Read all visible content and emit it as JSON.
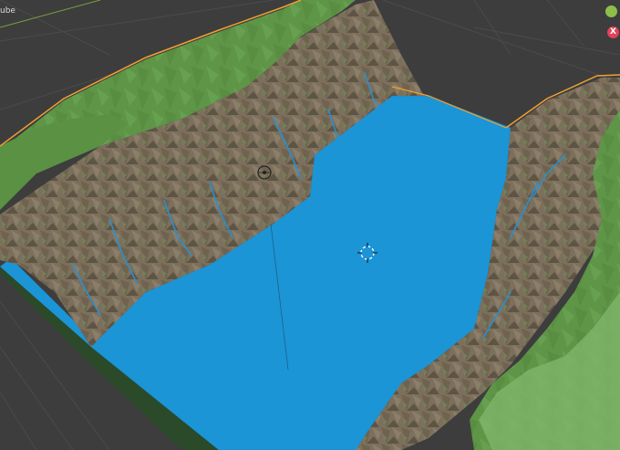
{
  "viewport": {
    "object_label": "ube",
    "gizmo": {
      "x_label": "X",
      "z_label": ""
    },
    "colors": {
      "background": "#3d3d3d",
      "grid": "#4a4a4a",
      "water": "#1b95d6",
      "rock": "#7d715e",
      "grass": "#5f9447",
      "selection_outline": "#f0a030",
      "axis_x": "#e0435a",
      "axis_y": "#8dbf4b"
    },
    "icons": [
      "origin-icon",
      "3d-cursor-icon",
      "light-empty-icon"
    ]
  }
}
